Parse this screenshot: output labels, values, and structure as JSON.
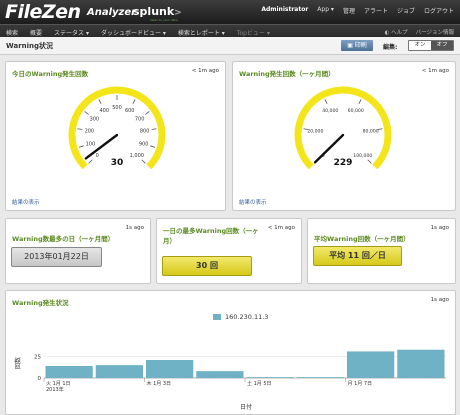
{
  "header": {
    "logo_main": "FileZen",
    "logo_sub": "Analyzer",
    "splunk": "splunk",
    "splunk_suffix": ">",
    "splunk_tagline": "listen to your data",
    "menu": [
      "Administrator",
      "App ▾",
      "管理",
      "アラート",
      "ジョブ",
      "ログアウト"
    ]
  },
  "nav": {
    "items": [
      "検索",
      "概要",
      "ステータス ▾",
      "ダッシュボードビュー ▾",
      "検索とレポート ▾",
      "Topビュー ▾"
    ],
    "right": [
      "◐ ヘルプ",
      "バージョン情報"
    ]
  },
  "titlebar": {
    "title": "Warning状況",
    "print": "印刷",
    "edit_label": "編集:",
    "toggle_on": "オン",
    "toggle_off": "オフ"
  },
  "panels": {
    "today": {
      "title": "今日のWarning発生回数",
      "time": "< 1m ago",
      "link": "結果の表示",
      "value": "30"
    },
    "month": {
      "title": "Warning発生回数（一ヶ月間）",
      "time": "< 1m ago",
      "link": "結果の表示",
      "value": "229"
    },
    "maxday": {
      "title": "Warning数最多の日（一ヶ月間）",
      "time": "1s ago",
      "value": "2013年01月22日"
    },
    "maxcount": {
      "title": "一日の最多Warning回数（一ヶ月）",
      "time": "< 1m ago",
      "value": "30 回"
    },
    "avg": {
      "title": "平均Warning回数（一ヶ月間）",
      "time": "1s ago",
      "value": "平均 11 回／日"
    },
    "chart": {
      "title": "Warning発生状況",
      "time": "1s ago"
    }
  },
  "gauges": [
    {
      "labels": [
        "0",
        "100",
        "200",
        "300",
        "400",
        "500",
        "600",
        "700",
        "800",
        "900",
        "1,000"
      ],
      "max": 1000,
      "value": 30
    },
    {
      "labels": [
        "0",
        "20,000",
        "40,000",
        "60,000",
        "80,000",
        "100,000"
      ],
      "max": 100000,
      "value": 229
    }
  ],
  "chart_data": {
    "type": "bar",
    "series": [
      {
        "name": "160.230.11.3",
        "values": [
          14,
          15,
          21,
          8,
          1,
          1,
          31,
          33
        ]
      }
    ],
    "x_tick_labels": [
      "火 1月 1日\n2013年",
      "木 1月 3日",
      "土 1月 5日",
      "月 1月 7日"
    ],
    "yticks": [
      "25",
      "0"
    ],
    "ylabel": "回数",
    "xlabel": "日付",
    "ylim": [
      0,
      35
    ]
  },
  "colors": {
    "gauge_yellow": "#f4e51b",
    "bar": "#6fb1c5",
    "title_green": "#5a8a1f",
    "link": "#345e9c"
  }
}
